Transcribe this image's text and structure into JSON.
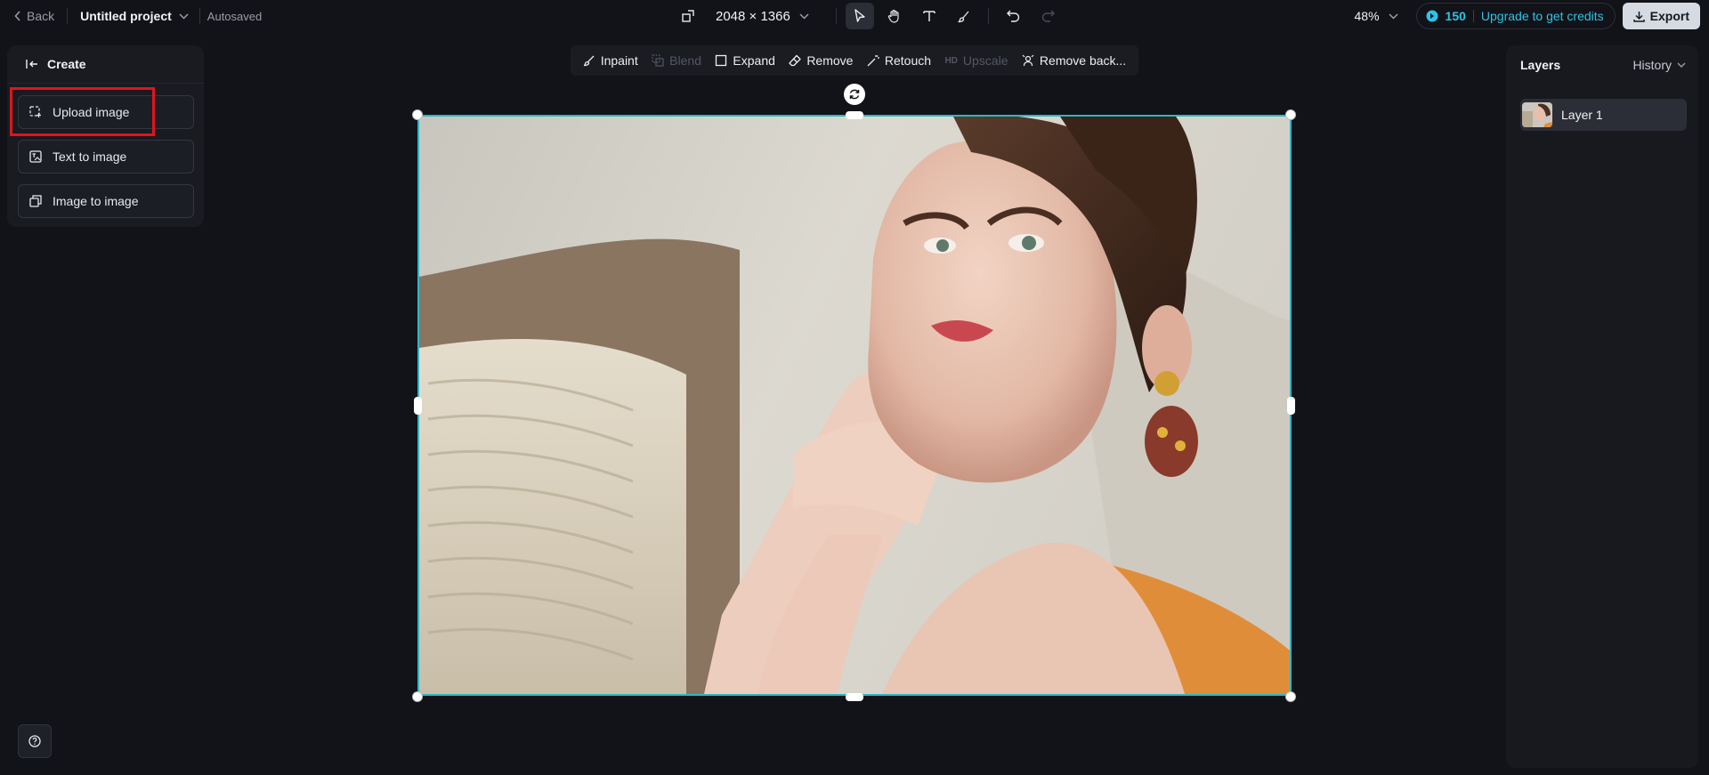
{
  "topbar": {
    "back_label": "Back",
    "project_name": "Untitled project",
    "autosave_status": "Autosaved",
    "dimensions": "2048 × 1366",
    "zoom": "48%",
    "credits": "150",
    "upgrade_label": "Upgrade to get credits",
    "export_label": "Export"
  },
  "left_panel": {
    "title": "Create",
    "items": [
      {
        "label": "Upload image",
        "icon": "upload-image-icon"
      },
      {
        "label": "Text to image",
        "icon": "text-to-image-icon"
      },
      {
        "label": "Image to image",
        "icon": "image-to-image-icon"
      }
    ]
  },
  "edit_toolbar": {
    "items": [
      {
        "label": "Inpaint",
        "enabled": true
      },
      {
        "label": "Blend",
        "enabled": false
      },
      {
        "label": "Expand",
        "enabled": true
      },
      {
        "label": "Remove",
        "enabled": true
      },
      {
        "label": "Retouch",
        "enabled": true
      },
      {
        "label": "Upscale",
        "badge": "HD",
        "enabled": false
      },
      {
        "label": "Remove back...",
        "enabled": true
      }
    ]
  },
  "right_panel": {
    "title": "Layers",
    "history_label": "History",
    "layers": [
      {
        "name": "Layer 1"
      }
    ]
  },
  "colors": {
    "accent": "#2ec3e6",
    "selection": "#29b7c9",
    "highlight": "#e0141b",
    "background": "#121318"
  }
}
